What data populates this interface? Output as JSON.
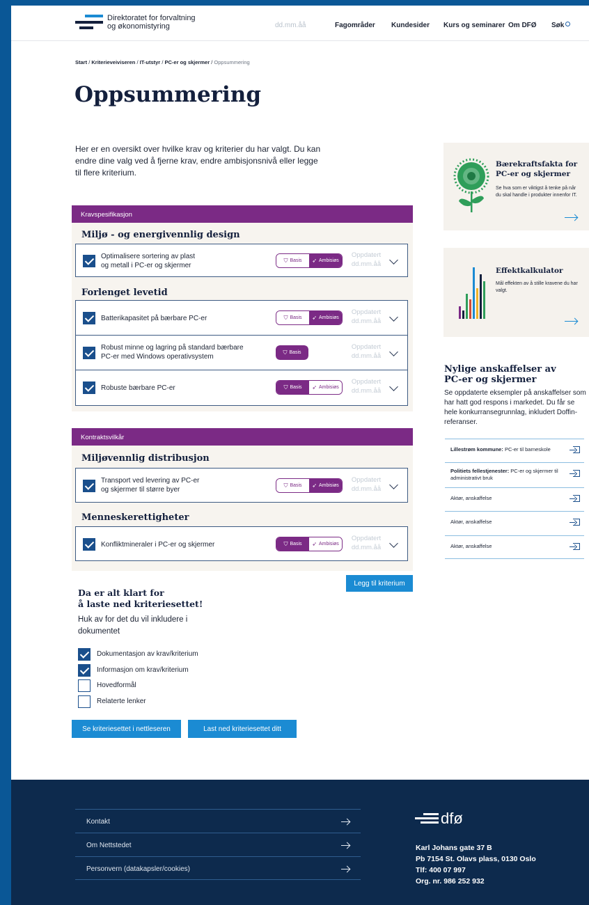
{
  "header": {
    "org_line1": "Direktoratet for forvaltning",
    "org_line2": "og økonomistyring",
    "date": "dd.mm.åå",
    "nav": [
      "Fagområder",
      "Kundesider",
      "Kurs og seminarer",
      "Om DFØ",
      "Søk"
    ]
  },
  "breadcrumb": {
    "items": [
      "Start",
      "Kriterieveiviseren",
      "IT-utstyr",
      "PC-er og skjermer"
    ],
    "current": "Oppsummering",
    "separator": "/"
  },
  "page_title": "Oppsummering",
  "intro": "Her er en oversikt over hvilke krav og kriterier du har valgt. Du kan endre dine valg ved å fjerne krav, endre ambisjonsnivå eller legge til flere kriterium.",
  "labels": {
    "basis": "Basis",
    "ambisjon": "Ambisiøs",
    "updated_1": "Oppdatert",
    "updated_2": "dd.mm.åå"
  },
  "sections": [
    {
      "header": "Kravspesifikasjon",
      "groups": [
        {
          "title": "Miljø - og energivennlig design",
          "items": [
            {
              "label_1": "Optimalisere sortering av plast",
              "label_2": "og metall i PC-er og skjermer",
              "checked": true,
              "level": "ambisjon"
            }
          ]
        },
        {
          "title": "Forlenget levetid",
          "items": [
            {
              "label_1": "Batterikapasitet på bærbare PC-er",
              "label_2": "",
              "checked": true,
              "level": "ambisjon"
            },
            {
              "label_1": "Robust minne og lagring på standard bærbare",
              "label_2": "PC-er med Windows operativsystem",
              "checked": true,
              "level": "basis-only"
            },
            {
              "label_1": "Robuste bærbare PC-er",
              "label_2": "",
              "checked": true,
              "level": "basis"
            }
          ]
        }
      ]
    },
    {
      "header": "Kontraktsvilkår",
      "groups": [
        {
          "title": "Miljøvennlig distribusjon",
          "items": [
            {
              "label_1": "Transport ved levering av PC-er",
              "label_2": "og skjermer til større byer",
              "checked": true,
              "level": "ambisjon"
            }
          ]
        },
        {
          "title": "Menneskerettigheter",
          "items": [
            {
              "label_1": "Konfliktmineraler i PC-er og skjermer",
              "label_2": "",
              "checked": true,
              "level": "basis"
            }
          ]
        }
      ]
    }
  ],
  "add_button": "Legg til kriterium",
  "download": {
    "title_1": "Da er alt klart for",
    "title_2": "å laste ned kriteriesettet!",
    "subtitle": "Huk av for det du vil inkludere i dokumentet",
    "options": [
      {
        "label": "Dokumentasjon av krav/kriterium",
        "checked": true
      },
      {
        "label": "Informasjon om krav/kriterium",
        "checked": true
      },
      {
        "label": "Hovedformål",
        "checked": false
      },
      {
        "label": "Relaterte lenker",
        "checked": false
      }
    ],
    "view_button": "Se kriteriesettet i nettleseren",
    "download_button": "Last ned kriteriesettet ditt"
  },
  "side": {
    "sustain_title_1": "Bærekraftsfakta for",
    "sustain_title_2": "PC-er og skjermer",
    "sustain_text": "Se hva som er viktigst å tenke på når du skal handle i produkter innenfor IT.",
    "calc_title": "Effektkalkulator",
    "calc_text": "Mål effekten av å stille kravene du har valgt.",
    "recent_title_1": "Nylige anskaffelser av",
    "recent_title_2": "PC-er og skjermer",
    "recent_text": "Se oppdaterte eksempler på anskaffelser som har hatt god respons i markedet. Du får se hele konkurransegrunnlag, inkludert Doffin-referanser.",
    "procurements": [
      {
        "bold": "Lillestrøm kommune:",
        "rest": " PC-er til barneskole"
      },
      {
        "bold": "Politiets fellestjenester:",
        "rest": " PC-er og skjermer til administrativt bruk"
      },
      {
        "bold": "",
        "rest": "Aktør, anskaffelse"
      },
      {
        "bold": "",
        "rest": "Aktør, anskaffelse"
      },
      {
        "bold": "",
        "rest": "Aktør, anskaffelse"
      }
    ]
  },
  "footer": {
    "links": [
      "Kontakt",
      "Om Nettstedet",
      "Personvern (datakapsler/cookies)"
    ],
    "logo_text": "dfø",
    "address": [
      "Karl Johans gate 37 B",
      "Pb 7154 St. Olavs plass, 0130 Oslo",
      "Tlf: 400 07 997",
      "Org. nr. 986 252 932"
    ]
  },
  "colors": {
    "brand_blue": "#0a5796",
    "purple": "#7b2a85",
    "accent_blue": "#1b8bd3",
    "footer_navy": "#0d2a4d",
    "checkbox_blue": "#1a4f8c"
  }
}
